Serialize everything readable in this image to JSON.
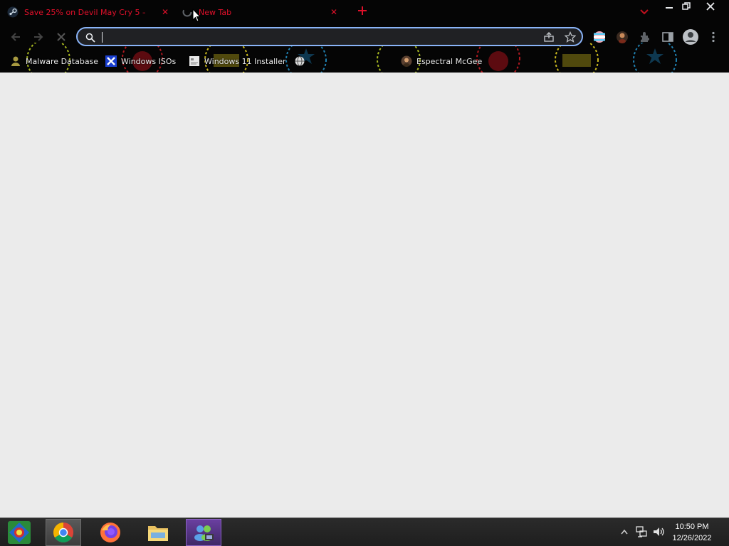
{
  "tabs": [
    {
      "title": "Save 25% on Devil May Cry 5 – ...",
      "favicon": "steam-icon",
      "active": false
    },
    {
      "title": "New Tab",
      "favicon": "loading-icon",
      "active": true
    }
  ],
  "omnibox": {
    "value": "",
    "placeholder": ""
  },
  "bookmarks": [
    {
      "label": "Malware Database",
      "icon": "user-icon"
    },
    {
      "label": "Windows ISOs",
      "icon": "x-logo-icon"
    },
    {
      "label": "Windows 11 Installer",
      "icon": "page-icon"
    },
    {
      "label": "",
      "icon": "globe-icon"
    },
    {
      "label": "Espectral McGee",
      "icon": "avatar-icon"
    }
  ],
  "taskbar": {
    "apps": [
      "start-orb",
      "chrome",
      "firefox",
      "file-explorer",
      "windows-live-messenger"
    ],
    "time": "10:50 PM",
    "date": "12/26/2022"
  },
  "colors": {
    "accent_red": "#e0102a",
    "omnibox_border": "#8ab4f8",
    "frame": "#050505",
    "page_background": "#ebebeb"
  }
}
